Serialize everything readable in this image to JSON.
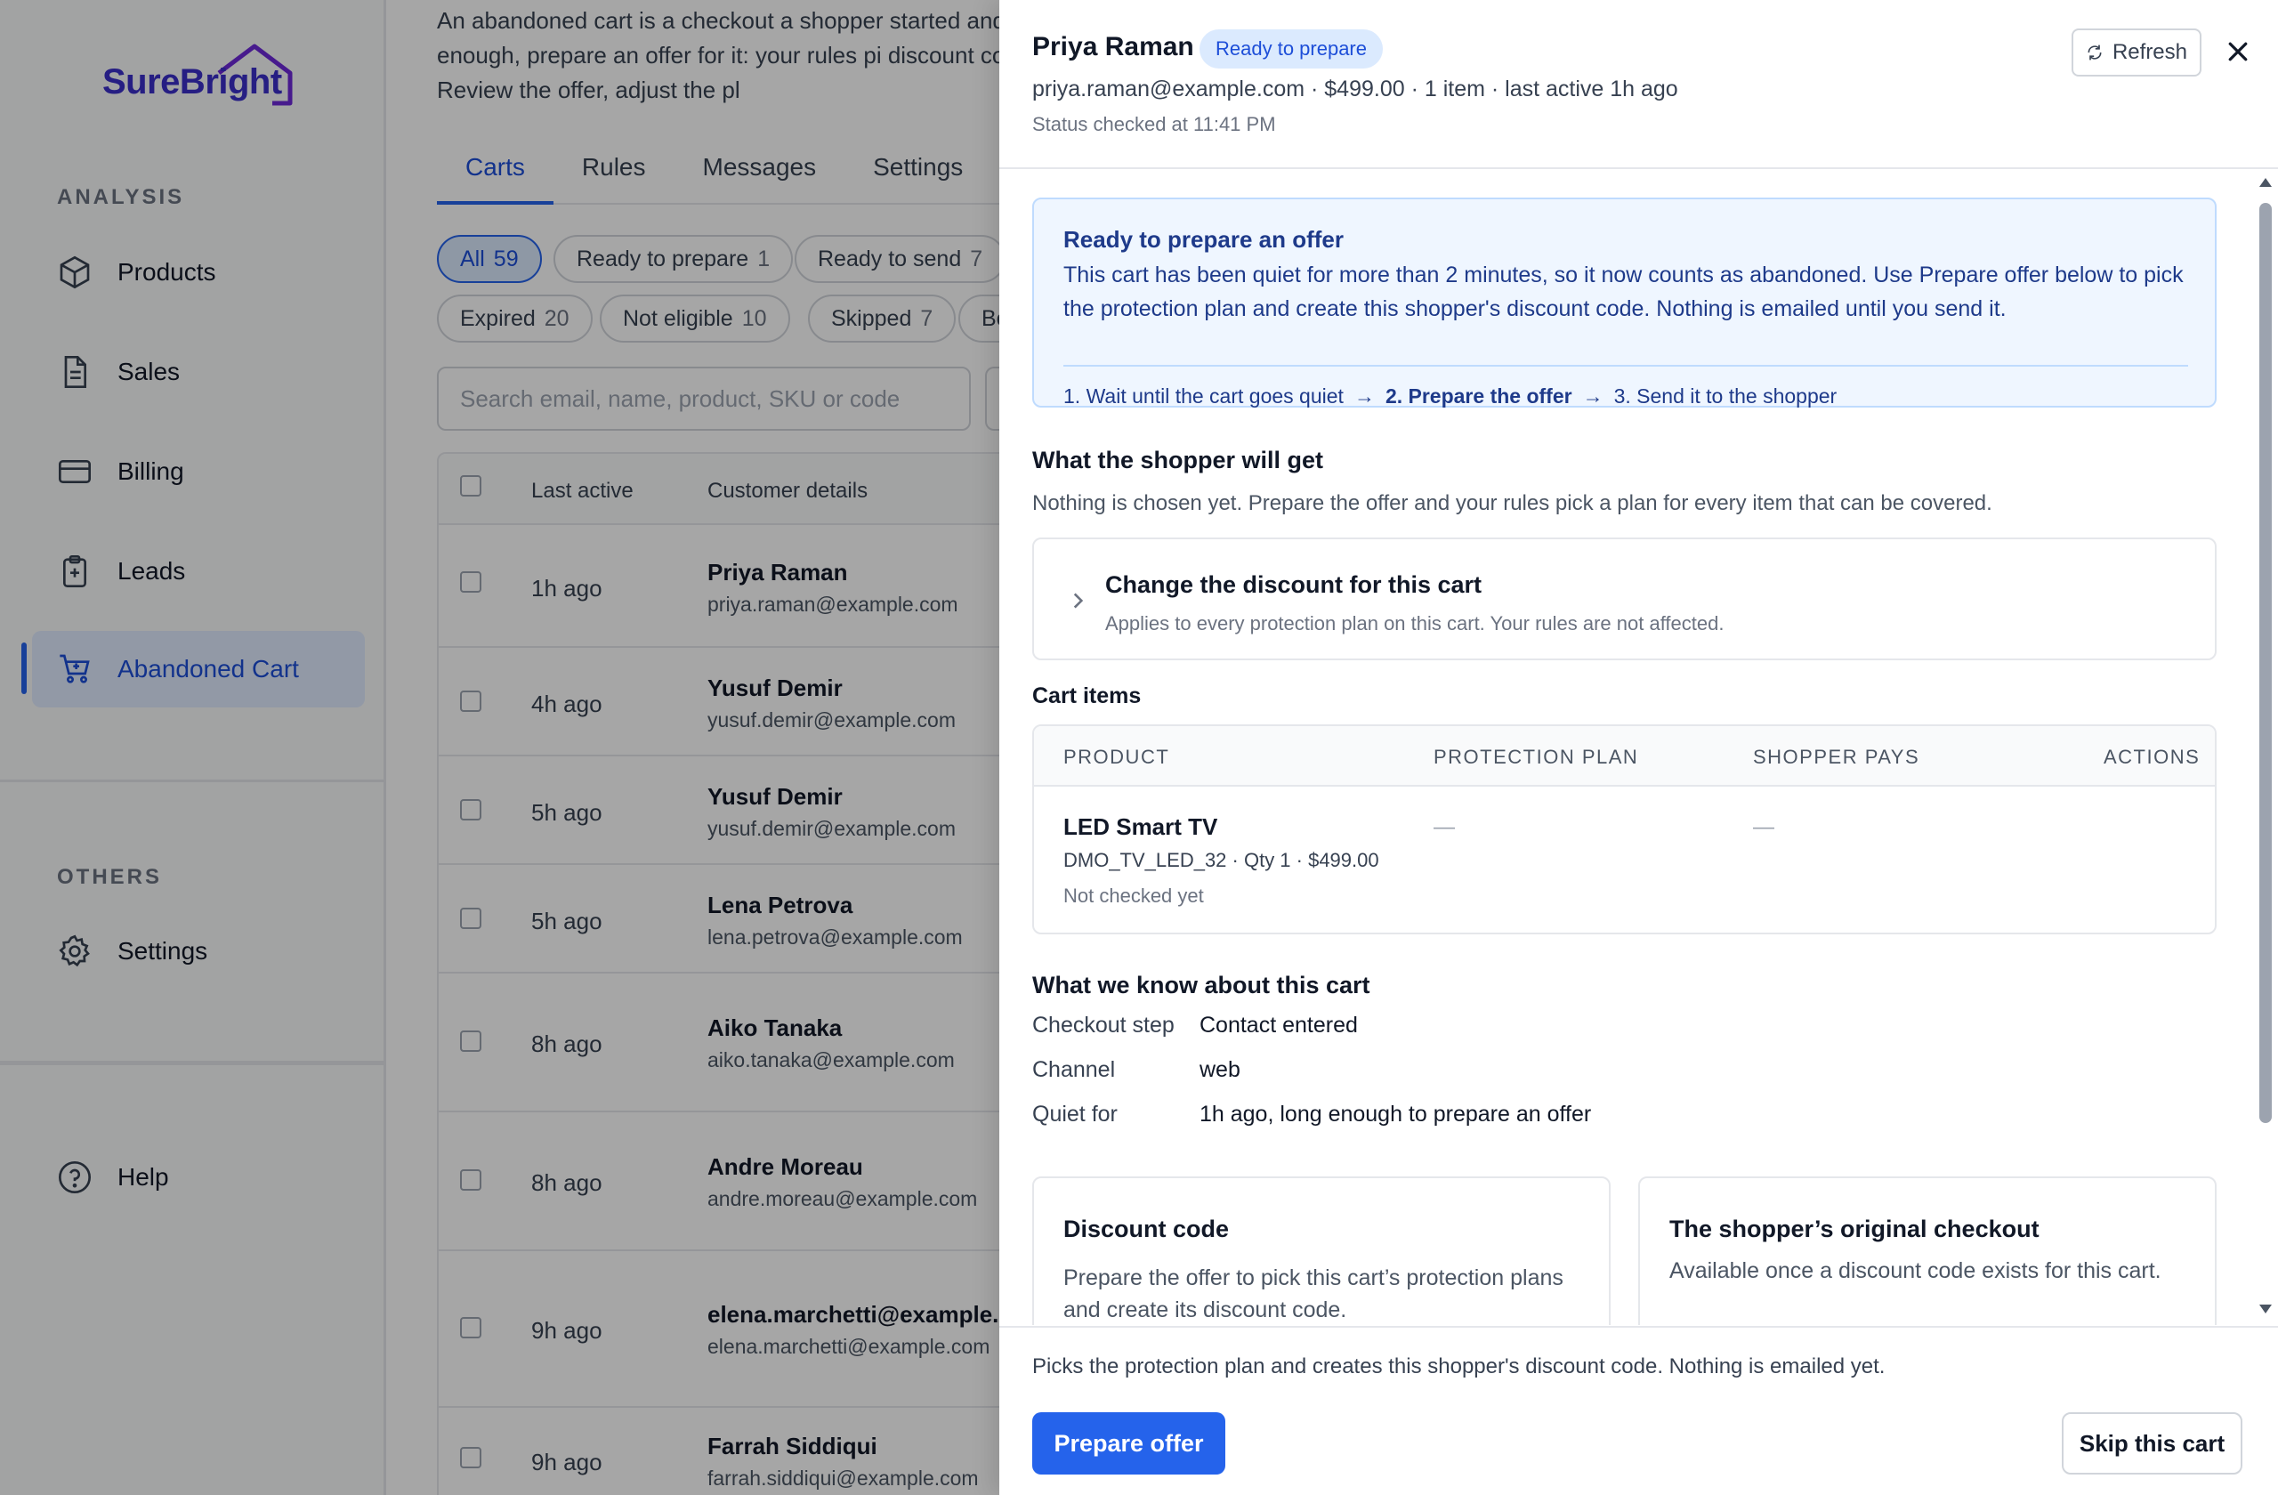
{
  "brand": {
    "name": "SureBright"
  },
  "sidebar": {
    "analysis_label": "ANALYSIS",
    "others_label": "OTHERS",
    "items": [
      {
        "label": "Products",
        "icon": "cube-icon"
      },
      {
        "label": "Sales",
        "icon": "document-icon"
      },
      {
        "label": "Billing",
        "icon": "credit-card-icon"
      },
      {
        "label": "Leads",
        "icon": "clipboard-icon"
      },
      {
        "label": "Abandoned Cart",
        "icon": "cart-icon",
        "active": true
      }
    ],
    "settings": "Settings",
    "help": "Help"
  },
  "main": {
    "intro": "An abandoned cart is a checkout a shopper started and quiet long enough, prepare an offer for it: your rules pi discount code is created. Review the offer, adjust the pl",
    "tabs": [
      "Carts",
      "Rules",
      "Messages",
      "Settings"
    ],
    "filters": [
      {
        "label": "All",
        "count": "59"
      },
      {
        "label": "Ready to prepare",
        "count": "1"
      },
      {
        "label": "Ready to send",
        "count": "7"
      },
      {
        "label": "Expired",
        "count": "20"
      },
      {
        "label": "Not eligible",
        "count": "10"
      },
      {
        "label": "Skipped",
        "count": "7"
      },
      {
        "label": "Bo",
        "count": ""
      }
    ],
    "search_placeholder": "Search email, name, product, SKU or code",
    "table": {
      "headers": [
        "Last active",
        "Customer details"
      ],
      "rows": [
        {
          "time": "1h ago",
          "name": "Priya Raman",
          "email": "priya.raman@example.com"
        },
        {
          "time": "4h ago",
          "name": "Yusuf Demir",
          "email": "yusuf.demir@example.com"
        },
        {
          "time": "5h ago",
          "name": "Yusuf Demir",
          "email": "yusuf.demir@example.com"
        },
        {
          "time": "5h ago",
          "name": "Lena Petrova",
          "email": "lena.petrova@example.com"
        },
        {
          "time": "8h ago",
          "name": "Aiko Tanaka",
          "email": "aiko.tanaka@example.com"
        },
        {
          "time": "8h ago",
          "name": "Andre Moreau",
          "email": "andre.moreau@example.com"
        },
        {
          "time": "9h ago",
          "name": "elena.marchetti@example.c...",
          "email": "elena.marchetti@example.com"
        },
        {
          "time": "9h ago",
          "name": "Farrah Siddiqui",
          "email": "farrah.siddiqui@example.com"
        }
      ]
    }
  },
  "panel": {
    "name": "Priya Raman",
    "badge": "Ready to prepare",
    "summary": "priya.raman@example.com · $499.00 · 1 item · last active 1h ago",
    "status_checked": "Status checked at 11:41 PM",
    "refresh_label": "Refresh",
    "info": {
      "title": "Ready to prepare an offer",
      "text": "This cart has been quiet for more than 2 minutes, so it now counts as abandoned. Use Prepare offer below to pick the protection plan and create this shopper's discount code. Nothing is emailed until you send it.",
      "step1": "1. Wait until the cart goes quiet",
      "step2": "2. Prepare the offer",
      "step3": "3. Send it to the shopper",
      "arrow": "→"
    },
    "get": {
      "title": "What the shopper will get",
      "text": "Nothing is chosen yet. Prepare the offer and your rules pick a plan for every item that can be covered."
    },
    "discount_change": {
      "title": "Change the discount for this cart",
      "sub": "Applies to every protection plan on this cart. Your rules are not affected."
    },
    "cart_items": {
      "title": "Cart items",
      "headers": [
        "PRODUCT",
        "PROTECTION PLAN",
        "SHOPPER PAYS",
        "ACTIONS"
      ],
      "item": {
        "name": "LED Smart TV",
        "meta": "DMO_TV_LED_32 · Qty 1 · $499.00",
        "status": "Not checked yet",
        "plan": "—",
        "pays": "—"
      }
    },
    "know": {
      "title": "What we know about this cart",
      "facts": [
        {
          "k": "Checkout step",
          "v": "Contact entered"
        },
        {
          "k": "Channel",
          "v": "web"
        },
        {
          "k": "Quiet for",
          "v": "1h ago, long enough to prepare an offer"
        }
      ]
    },
    "discount_code": {
      "title": "Discount code",
      "text": "Prepare the offer to pick this cart’s protection plans and create its discount code."
    },
    "original_checkout": {
      "title": "The shopper’s original checkout",
      "text": "Available once a discount code exists for this cart."
    },
    "footer": {
      "text": "Picks the protection plan and creates this shopper's discount code. Nothing is emailed yet.",
      "prepare": "Prepare offer",
      "skip": "Skip this cart"
    }
  },
  "colors": {
    "accent": "#2563eb",
    "brand": "#3b2fc9",
    "info_bg": "#eff6ff"
  }
}
